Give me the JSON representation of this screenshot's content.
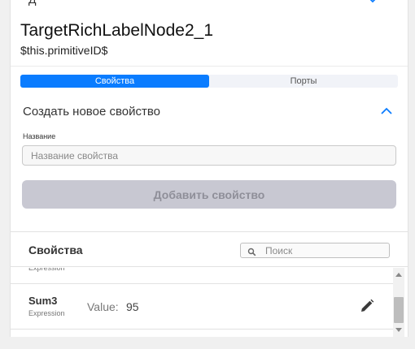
{
  "node": {
    "title": "TargetRichLabelNode2_1",
    "subtitle": "$this.primitiveID$"
  },
  "tabs": [
    {
      "label": "Свойства",
      "active": true
    },
    {
      "label": "Порты",
      "active": false
    }
  ],
  "create_property": {
    "title": "Создать новое свойство",
    "name_label": "Название",
    "name_placeholder": "Название свойства",
    "add_button_label": "Добавить свойство"
  },
  "properties": {
    "title": "Свойства",
    "search_placeholder": "Поиск",
    "partial_row_type": "Expression",
    "rows": [
      {
        "name": "Sum3",
        "type": "Expression",
        "value_label": "Value:",
        "value": "95"
      }
    ]
  },
  "colors": {
    "accent": "#0a7cff",
    "disabled_button": "#c8c8d2"
  }
}
